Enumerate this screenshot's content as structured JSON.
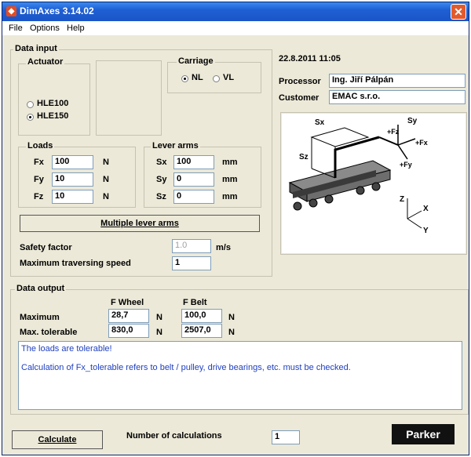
{
  "window": {
    "title": "DimAxes 3.14.02",
    "close_symbol": "✕"
  },
  "menu": {
    "items": [
      "File",
      "Options",
      "Help"
    ]
  },
  "data_input": {
    "label": "Data input",
    "actuator": {
      "label": "Actuator",
      "options": [
        "HLE100",
        "HLE150"
      ],
      "selected": "HLE150"
    },
    "carriage": {
      "label": "Carriage",
      "options": [
        "NL",
        "VL"
      ],
      "selected": "NL"
    },
    "loads": {
      "label": "Loads",
      "rows": [
        {
          "name": "Fx",
          "value": "100",
          "unit": "N"
        },
        {
          "name": "Fy",
          "value": "10",
          "unit": "N"
        },
        {
          "name": "Fz",
          "value": "10",
          "unit": "N"
        }
      ]
    },
    "lever_arms": {
      "label": "Lever arms",
      "rows": [
        {
          "name": "Sx",
          "value": "100",
          "unit": "mm"
        },
        {
          "name": "Sy",
          "value": "0",
          "unit": "mm"
        },
        {
          "name": "Sz",
          "value": "0",
          "unit": "mm"
        }
      ]
    },
    "multiple_button": "Multiple lever arms",
    "safety_factor": {
      "label": "Safety factor",
      "value": "1.0",
      "unit": "m/s"
    },
    "max_speed": {
      "label": "Maximum traversing speed",
      "value": "1"
    }
  },
  "info": {
    "datetime": "22.8.2011  11:05",
    "processor_label": "Processor",
    "processor_value": "Ing. Jiří Pálpán",
    "customer_label": "Customer",
    "customer_value": "EMAC s.r.o."
  },
  "diagram": {
    "labels": {
      "sx": "Sx",
      "sy": "Sy",
      "sz": "Sz",
      "fz": "+Fz",
      "fx": "+Fx",
      "fy": "+Fy",
      "ax_z": "Z",
      "ax_x": "X",
      "ax_y": "Y"
    }
  },
  "data_output": {
    "label": "Data output",
    "col_wheel": "F Wheel",
    "col_belt": "F Belt",
    "rows": [
      {
        "name": "Maximum",
        "wheel": "28,7",
        "wheel_unit": "N",
        "belt": "100,0",
        "belt_unit": "N"
      },
      {
        "name": "Max. tolerable",
        "wheel": "830,0",
        "wheel_unit": "N",
        "belt": "2507,0",
        "belt_unit": "N"
      }
    ],
    "messages": [
      "The loads are tolerable!",
      "Calculation of Fx_tolerable refers to belt / pulley, drive bearings, etc. must be checked."
    ]
  },
  "footer": {
    "calculate_button": "Calculate",
    "count_label": "Number of calculations",
    "count_value": "1",
    "logo_text": "Parker"
  },
  "colors": {
    "title_bar": "#1f5fd4",
    "message_text": "#1f3fbf",
    "window_bg": "#ece9d8"
  }
}
